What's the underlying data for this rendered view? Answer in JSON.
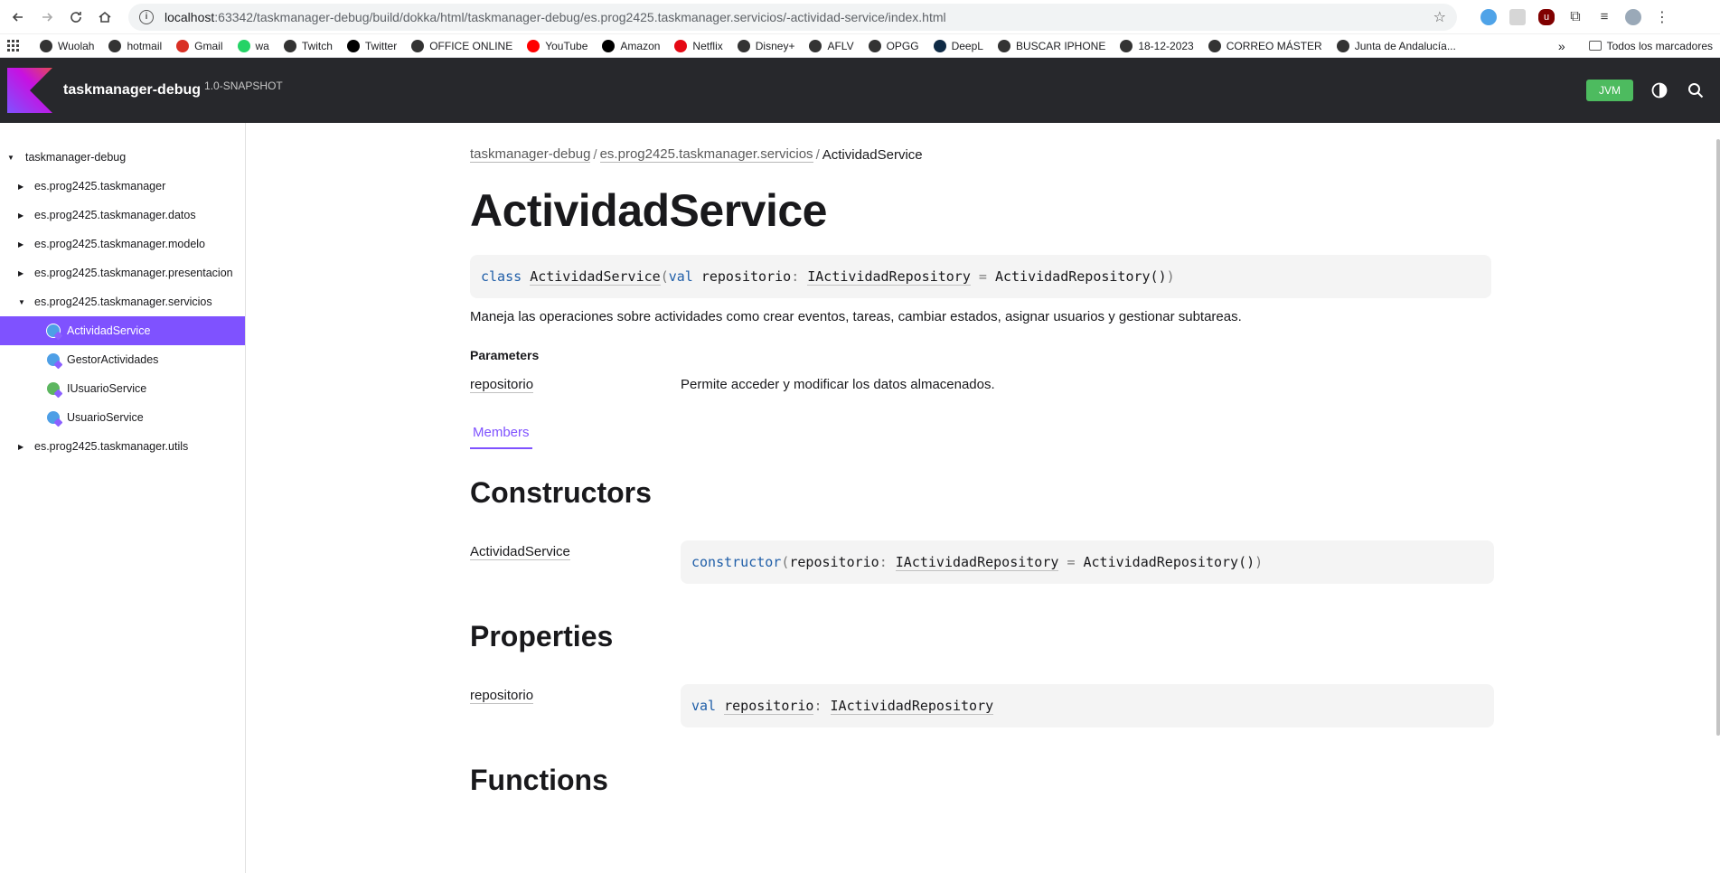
{
  "browser": {
    "url_host": "localhost",
    "url_path": ":63342/taskmanager-debug/build/dokka/html/taskmanager-debug/es.prog2425.taskmanager.servicios/-actividad-service/index.html",
    "bookmarks": [
      {
        "label": "Wuolah",
        "color": "#333333"
      },
      {
        "label": "hotmail",
        "color": "#333333"
      },
      {
        "label": "Gmail",
        "color": "#d93025"
      },
      {
        "label": "wa",
        "color": "#25d366"
      },
      {
        "label": "Twitch",
        "color": "#333333"
      },
      {
        "label": "Twitter",
        "color": "#000000"
      },
      {
        "label": "OFFICE ONLINE",
        "color": "#333333"
      },
      {
        "label": "YouTube",
        "color": "#ff0000"
      },
      {
        "label": "Amazon",
        "color": "#000000"
      },
      {
        "label": "Netflix",
        "color": "#e50914"
      },
      {
        "label": "Disney+",
        "color": "#333333"
      },
      {
        "label": "AFLV",
        "color": "#333333"
      },
      {
        "label": "OPGG",
        "color": "#333333"
      },
      {
        "label": "DeepL",
        "color": "#0f2b46"
      },
      {
        "label": "BUSCAR IPHONE",
        "color": "#333333"
      },
      {
        "label": "18-12-2023",
        "color": "#333333"
      },
      {
        "label": "CORREO MÁSTER",
        "color": "#333333"
      },
      {
        "label": "Junta de Andalucía...",
        "color": "#333333"
      }
    ],
    "more_bookmarks": "»",
    "all_bookmarks": "Todos los marcadores"
  },
  "header": {
    "project_name": "taskmanager-debug",
    "version": "1.0-SNAPSHOT",
    "platform": "JVM",
    "accent": "#7f52ff",
    "platform_color": "#4dbb5f"
  },
  "sidebar": {
    "root": "taskmanager-debug",
    "packages": [
      "es.prog2425.taskmanager",
      "es.prog2425.taskmanager.datos",
      "es.prog2425.taskmanager.modelo",
      "es.prog2425.taskmanager.presentacion",
      "es.prog2425.taskmanager.servicios"
    ],
    "classes": [
      {
        "label": "ActividadService",
        "kind": "class",
        "selected": true
      },
      {
        "label": "GestorActividades",
        "kind": "class",
        "selected": false
      },
      {
        "label": "IUsuarioService",
        "kind": "interface",
        "selected": false
      },
      {
        "label": "UsuarioService",
        "kind": "class",
        "selected": false
      }
    ],
    "last_package": "es.prog2425.taskmanager.utils"
  },
  "content": {
    "breadcrumbs": [
      "taskmanager-debug",
      "es.prog2425.taskmanager.servicios",
      "ActividadService"
    ],
    "breadcrumb_sep": "/",
    "title": "ActividadService",
    "signature": {
      "kw_class": "class",
      "name": "ActividadService",
      "open": "(",
      "kw_val": "val",
      "param": "repositorio",
      "colon": ":",
      "type": "IActividadRepository",
      "eq": "=",
      "default": "ActividadRepository()",
      "close": ")"
    },
    "description": "Maneja las operaciones sobre actividades como crear eventos, tareas, cambiar estados, asignar usuarios y gestionar subtareas.",
    "params_title": "Parameters",
    "param_name": "repositorio",
    "param_desc": "Permite acceder y modificar los datos almacenados.",
    "tab_members": "Members",
    "constructors_title": "Constructors",
    "constructor": {
      "name": "ActividadService",
      "kw": "constructor",
      "open": "(",
      "param": "repositorio",
      "colon": ":",
      "type": "IActividadRepository",
      "eq": "=",
      "default": "ActividadRepository()",
      "close": ")"
    },
    "properties_title": "Properties",
    "property": {
      "name": "repositorio",
      "kw": "val",
      "prop": "repositorio",
      "colon": ":",
      "type": "IActividadRepository"
    },
    "functions_title": "Functions"
  }
}
